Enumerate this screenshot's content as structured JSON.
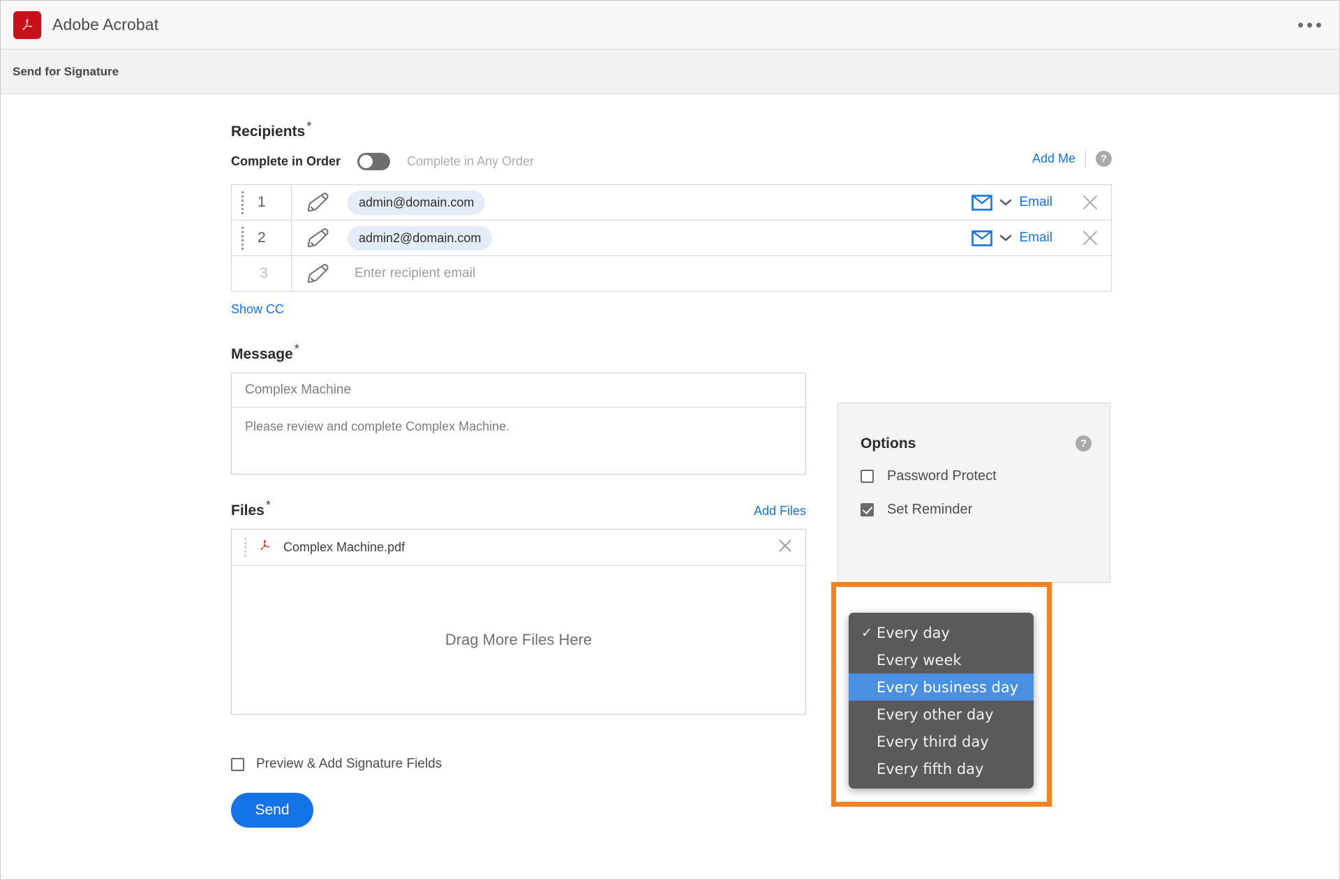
{
  "titlebar": {
    "app_name": "Adobe Acrobat",
    "logo_icon": "adobe-acrobat-logo",
    "overflow_icon": "more-options-icon"
  },
  "subheader": {
    "title": "Send for Signature"
  },
  "recipients": {
    "label": "Recipients",
    "required_mark": "*",
    "order_label": "Complete in Order",
    "order_alt_label": "Complete in Any Order",
    "toggle_state": "off",
    "add_me_label": "Add Me",
    "help_glyph": "?",
    "rows": [
      {
        "num": "1",
        "email": "admin@domain.com",
        "method": "Email",
        "has_email": true
      },
      {
        "num": "2",
        "email": "admin2@domain.com",
        "method": "Email",
        "has_email": true
      },
      {
        "num": "3",
        "email": "Enter recipient email",
        "method": "",
        "has_email": false
      }
    ],
    "show_cc_label": "Show CC"
  },
  "message": {
    "label": "Message",
    "required_mark": "*",
    "subject": "Complex Machine",
    "body": "Please review and complete Complex Machine."
  },
  "files": {
    "label": "Files",
    "required_mark": "*",
    "add_files_label": "Add Files",
    "items": [
      {
        "name": "Complex Machine.pdf",
        "icon": "pdf-file-icon"
      }
    ],
    "drop_hint": "Drag More Files Here"
  },
  "bottom": {
    "preview_label": "Preview & Add Signature Fields",
    "preview_checked": false,
    "send_label": "Send"
  },
  "options": {
    "title": "Options",
    "help_glyph": "?",
    "password_protect": {
      "label": "Password Protect",
      "checked": false
    },
    "set_reminder": {
      "label": "Set Reminder",
      "checked": true
    }
  },
  "reminder_dropdown": {
    "selected": "Every day",
    "highlighted": "Every business day",
    "check_glyph": "✓",
    "items": [
      {
        "label": "Every day",
        "selected": true,
        "highlighted": false
      },
      {
        "label": "Every week",
        "selected": false,
        "highlighted": false
      },
      {
        "label": "Every business day",
        "selected": false,
        "highlighted": true
      },
      {
        "label": "Every other day",
        "selected": false,
        "highlighted": false
      },
      {
        "label": "Every third day",
        "selected": false,
        "highlighted": false
      },
      {
        "label": "Every fifth day",
        "selected": false,
        "highlighted": false
      }
    ]
  },
  "colors": {
    "accent_blue": "#1473e6",
    "highlight_orange": "#f58220",
    "dropdown_bg": "#5a5a5a",
    "dropdown_highlight": "#4a90e2",
    "acrobat_red": "#c8101b"
  }
}
